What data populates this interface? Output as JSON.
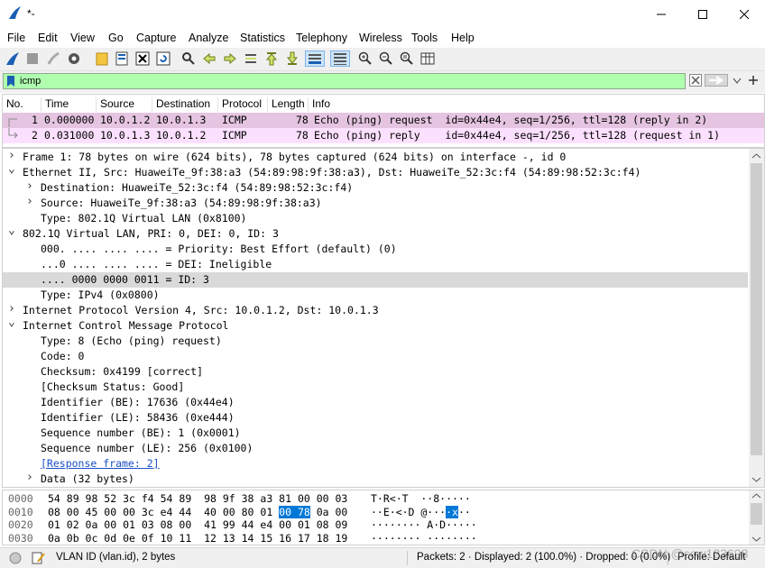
{
  "window": {
    "title": "*-"
  },
  "menu": [
    "File",
    "Edit",
    "View",
    "Go",
    "Capture",
    "Analyze",
    "Statistics",
    "Telephony",
    "Wireless",
    "Tools",
    "Help"
  ],
  "filter": {
    "value": "icmp"
  },
  "packet_list": {
    "columns": [
      "No.",
      "Time",
      "Source",
      "Destination",
      "Protocol",
      "Length",
      "Info"
    ],
    "rows": [
      {
        "no": "1",
        "time": "0.000000",
        "src": "10.0.1.2",
        "dst": "10.0.1.3",
        "proto": "ICMP",
        "len": "78",
        "info": "Echo (ping) request  id=0x44e4, seq=1/256, ttl=128 (reply in 2)",
        "color": "#e4c4e0"
      },
      {
        "no": "2",
        "time": "0.031000",
        "src": "10.0.1.3",
        "dst": "10.0.1.2",
        "proto": "ICMP",
        "len": "78",
        "info": "Echo (ping) reply    id=0x44e4, seq=1/256, ttl=128 (request in 1)",
        "color": "#fce0ff"
      }
    ]
  },
  "details": [
    {
      "indent": 0,
      "arrow": "collapsed",
      "text": "Frame 1: 78 bytes on wire (624 bits), 78 bytes captured (624 bits) on interface -, id 0"
    },
    {
      "indent": 0,
      "arrow": "expanded",
      "text": "Ethernet II, Src: HuaweiTe_9f:38:a3 (54:89:98:9f:38:a3), Dst: HuaweiTe_52:3c:f4 (54:89:98:52:3c:f4)"
    },
    {
      "indent": 1,
      "arrow": "collapsed",
      "text": "Destination: HuaweiTe_52:3c:f4 (54:89:98:52:3c:f4)"
    },
    {
      "indent": 1,
      "arrow": "collapsed",
      "text": "Source: HuaweiTe_9f:38:a3 (54:89:98:9f:38:a3)"
    },
    {
      "indent": 1,
      "arrow": "none",
      "text": "Type: 802.1Q Virtual LAN (0x8100)"
    },
    {
      "indent": 0,
      "arrow": "expanded",
      "text": "802.1Q Virtual LAN, PRI: 0, DEI: 0, ID: 3"
    },
    {
      "indent": 1,
      "arrow": "none",
      "text": "000. .... .... .... = Priority: Best Effort (default) (0)"
    },
    {
      "indent": 1,
      "arrow": "none",
      "text": "...0 .... .... .... = DEI: Ineligible"
    },
    {
      "indent": 1,
      "arrow": "none",
      "text": ".... 0000 0000 0011 = ID: 3",
      "selected": true
    },
    {
      "indent": 1,
      "arrow": "none",
      "text": "Type: IPv4 (0x0800)"
    },
    {
      "indent": 0,
      "arrow": "collapsed",
      "text": "Internet Protocol Version 4, Src: 10.0.1.2, Dst: 10.0.1.3"
    },
    {
      "indent": 0,
      "arrow": "expanded",
      "text": "Internet Control Message Protocol"
    },
    {
      "indent": 1,
      "arrow": "none",
      "text": "Type: 8 (Echo (ping) request)"
    },
    {
      "indent": 1,
      "arrow": "none",
      "text": "Code: 0"
    },
    {
      "indent": 1,
      "arrow": "none",
      "text": "Checksum: 0x4199 [correct]"
    },
    {
      "indent": 1,
      "arrow": "none",
      "text": "[Checksum Status: Good]"
    },
    {
      "indent": 1,
      "arrow": "none",
      "text": "Identifier (BE): 17636 (0x44e4)"
    },
    {
      "indent": 1,
      "arrow": "none",
      "text": "Identifier (LE): 58436 (0xe444)"
    },
    {
      "indent": 1,
      "arrow": "none",
      "text": "Sequence number (BE): 1 (0x0001)"
    },
    {
      "indent": 1,
      "arrow": "none",
      "text": "Sequence number (LE): 256 (0x0100)"
    },
    {
      "indent": 1,
      "arrow": "none",
      "text": "[Response frame: 2]",
      "link": true
    },
    {
      "indent": 1,
      "arrow": "collapsed",
      "text": "Data (32 bytes)"
    }
  ],
  "bytes": [
    {
      "offset": "0000",
      "hex_pre": "54 89 98 52 3c f4 54 89  98 9f 38 a3 81 00 00 03",
      "hl": "",
      "hex_post": "",
      "ascii_pre": "T·R<·T  ··8·····",
      "ascii_hl": "",
      "ascii_post": ""
    },
    {
      "offset": "0010",
      "hex_pre": "08 00 45 00 00 3c e4 44  40 00 80 01 ",
      "hl": "00 78",
      "hex_post": " 0a 00",
      "ascii_pre": "··E·<·D @···",
      "ascii_hl": "·x",
      "ascii_post": "··"
    },
    {
      "offset": "0020",
      "hex_pre": "01 02 0a 00 01 03 08 00  41 99 44 e4 00 01 08 09",
      "hl": "",
      "hex_post": "",
      "ascii_pre": "········ A·D·····",
      "ascii_hl": "",
      "ascii_post": ""
    },
    {
      "offset": "0030",
      "hex_pre": "0a 0b 0c 0d 0e 0f 10 11  12 13 14 15 16 17 18 19",
      "hl": "",
      "hex_post": "",
      "ascii_pre": "········ ········",
      "ascii_hl": "",
      "ascii_post": ""
    }
  ],
  "status": {
    "field": "VLAN ID (vlan.id), 2 bytes",
    "counts": "Packets: 2 · Displayed: 2 (100.0%) · Dropped: 0 (0.0%)",
    "profile": "Profile: Default",
    "watermark": "CSDN @cow123698"
  },
  "colors": {
    "filter_bg": "#afffaf",
    "row1": "#e4c4e0",
    "row2": "#fce0ff",
    "selected": "#d9d9d9",
    "byte_highlight": "#0078d7"
  }
}
